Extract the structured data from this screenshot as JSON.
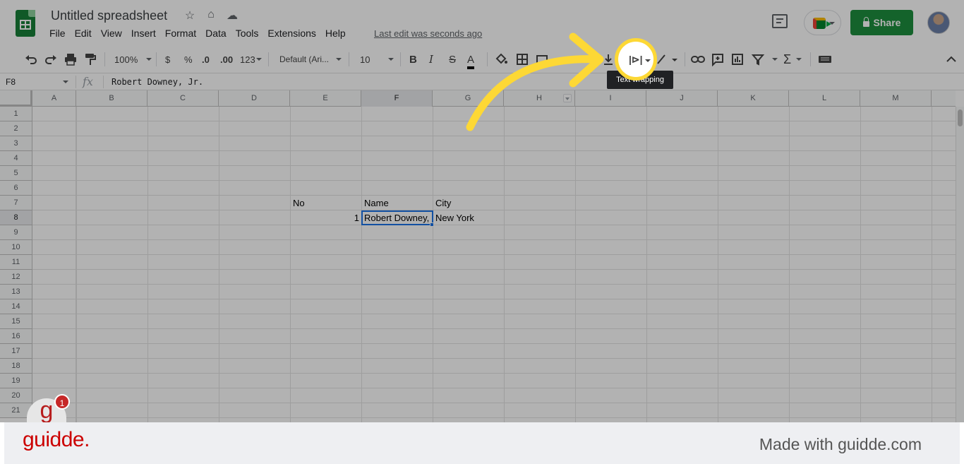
{
  "titlebar": {
    "doc_title": "Untitled spreadsheet",
    "menu": [
      "File",
      "Edit",
      "View",
      "Insert",
      "Format",
      "Data",
      "Tools",
      "Extensions",
      "Help"
    ],
    "last_edit": "Last edit was seconds ago",
    "share_label": "Share"
  },
  "toolbar": {
    "zoom": "100%",
    "currency": "$",
    "percent": "%",
    "decrease_decimal": ".0",
    "increase_decimal": ".00",
    "more_formats": "123",
    "font": "Default (Ari...",
    "font_size": "10",
    "bold": "B",
    "italic": "I",
    "strikethrough": "S",
    "text_color": "A",
    "sigma": "Σ",
    "tooltip": "Text wrapping"
  },
  "formula_bar": {
    "name_box": "F8",
    "fx": "fx",
    "value": "Robert Downey, Jr."
  },
  "grid": {
    "columns": [
      "A",
      "B",
      "C",
      "D",
      "E",
      "F",
      "G",
      "H",
      "I",
      "J",
      "K",
      "L",
      "M"
    ],
    "rows": [
      "1",
      "2",
      "3",
      "4",
      "5",
      "6",
      "7",
      "8",
      "9",
      "10",
      "11",
      "12",
      "13",
      "14",
      "15",
      "16",
      "17",
      "18",
      "19",
      "20",
      "21"
    ],
    "cells": {
      "E7": "No",
      "F7": "Name",
      "G7": "City",
      "E8": "1",
      "F8": "Robert Downey,",
      "G8": "New York"
    }
  },
  "badge": {
    "letter": "g",
    "count": "1"
  },
  "footer": {
    "logo": "guidde.",
    "made_with": "Made with guidde.com"
  },
  "colors": {
    "share": "#1e8e3e",
    "selection": "#1a73e8",
    "highlight": "#fdd835",
    "brand": "#c00000"
  }
}
